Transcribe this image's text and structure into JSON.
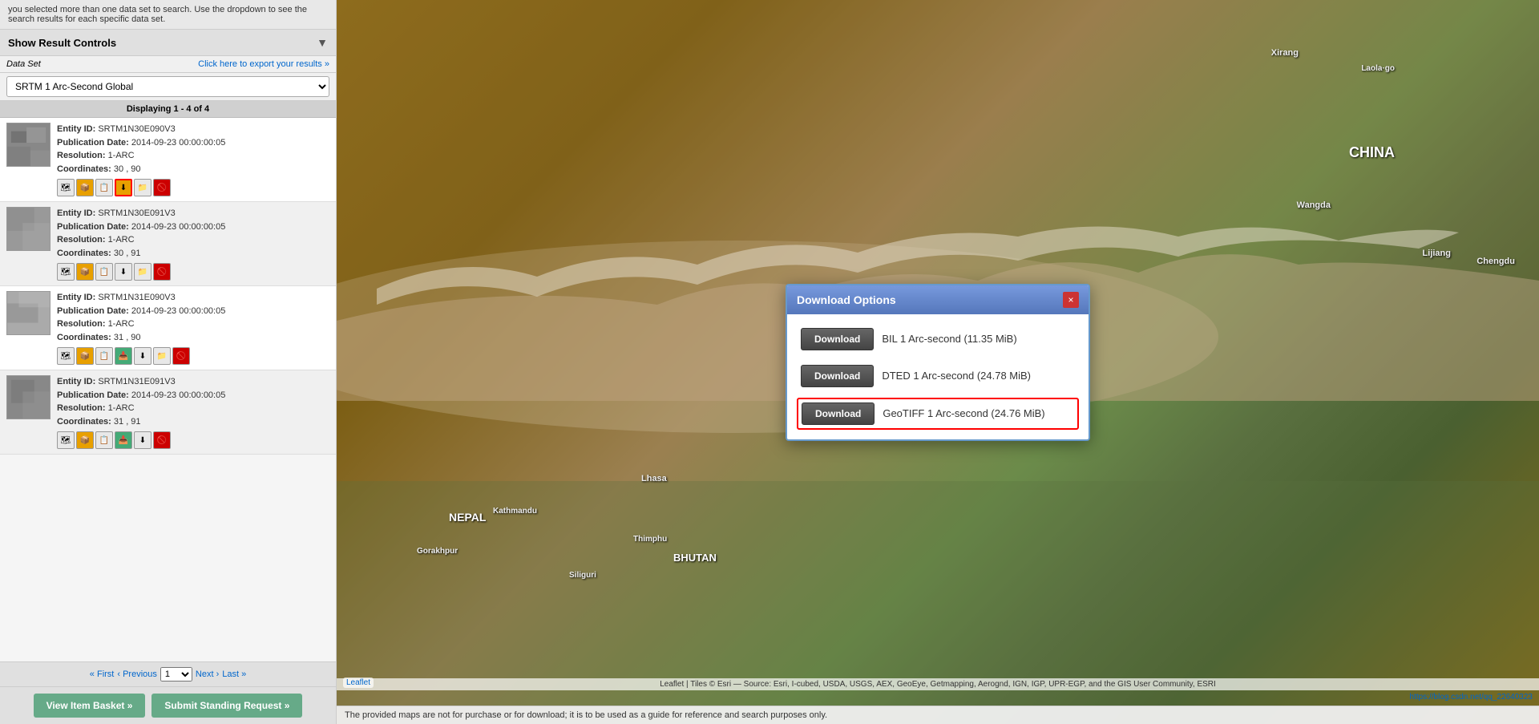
{
  "top_notice": "you selected more than one data set to search. Use the dropdown to see the search results for each specific data set.",
  "show_result_controls": {
    "label": "Show Result Controls",
    "arrow": "▼"
  },
  "dataset": {
    "label": "Data Set",
    "export_text": "Click here to export your results »",
    "current_value": "SRTM 1 Arc-Second Global"
  },
  "displaying": "Displaying 1 - 4 of 4",
  "results": [
    {
      "id": "SRTM1N30E090V3",
      "pub_date": "2014-09-23 00:00:00:05",
      "resolution": "1-ARC",
      "coords": "30 , 90",
      "thumb_color": "#777"
    },
    {
      "id": "SRTM1N30E091V3",
      "pub_date": "2014-09-23 00:00:00:05",
      "resolution": "1-ARC",
      "coords": "30 , 91",
      "thumb_color": "#888"
    },
    {
      "id": "SRTM1N31E090V3",
      "pub_date": "2014-09-23 00:00:00:05",
      "resolution": "1-ARC",
      "coords": "31 , 90",
      "thumb_color": "#999"
    },
    {
      "id": "SRTM1N31E091V3",
      "pub_date": "2014-09-23 00:00:00:05",
      "resolution": "1-ARC",
      "coords": "31 , 91",
      "thumb_color": "#888"
    }
  ],
  "pagination": {
    "first": "« First",
    "prev": "‹ Previous",
    "page": "1",
    "next": "Next ›",
    "last": "Last »"
  },
  "buttons": {
    "view_basket": "View Item Basket »",
    "submit_standing": "Submit Standing Request »"
  },
  "modal": {
    "title": "Download Options",
    "close_label": "×",
    "options": [
      {
        "button_label": "Download",
        "file_label": "BIL 1 Arc-second (11.35 MiB)",
        "highlighted": false
      },
      {
        "button_label": "Download",
        "file_label": "DTED 1 Arc-second (24.78 MiB)",
        "highlighted": false
      },
      {
        "button_label": "Download",
        "file_label": "GeoTIFF 1 Arc-second (24.76 MiB)",
        "highlighted": true
      }
    ]
  },
  "map": {
    "labels": {
      "china": "CHINA",
      "nepal": "NEPAL",
      "bhutan": "BHUTAN",
      "lhasa": "Lhasa",
      "kathmandu": "Kathmandu",
      "thimphu": "Thimphu",
      "gorakhpur": "Gorakhpur",
      "siliguri": "Siliguri",
      "wangda": "Wangda",
      "lijiang": "Lijiang",
      "chengdu": "Chengdu",
      "xirang": "Xirang",
      "laolaigo": "Laola·go"
    },
    "attribution": "Leaflet | Tiles © Esri — Source: Esri, I-cubed, USDA, USGS, AEX, GeoEye, Getmapping, Aerognd, IGN, IGP, UPR-EGP, and the GIS User Community, ESRI",
    "notice": "The provided maps are not for purchase or for download; it is to be used as a guide for reference and search purposes only.",
    "url": "https://blog.csdn.net/qq_22640323"
  },
  "fields": {
    "entity_id": "Entity ID:",
    "pub_date": "Publication Date:",
    "resolution": "Resolution:",
    "coordinates": "Coordinates:"
  }
}
